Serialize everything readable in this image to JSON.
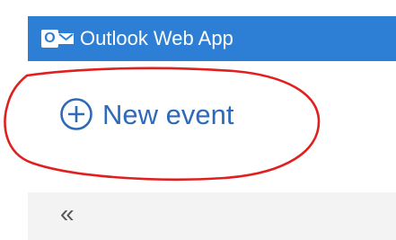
{
  "header": {
    "logo_letter": "O",
    "app_title": "Outlook Web App",
    "bar_color": "#2d7fd6",
    "logo_icon": "outlook-logo-icon"
  },
  "actions": {
    "new_event_label": "New event",
    "new_event_icon": "plus-circle-icon",
    "text_color": "#2d6ab8"
  },
  "navigation": {
    "collapse_glyph": "«",
    "collapse_icon": "double-chevron-left-icon"
  },
  "annotation": {
    "stroke_color": "#e0201f"
  }
}
